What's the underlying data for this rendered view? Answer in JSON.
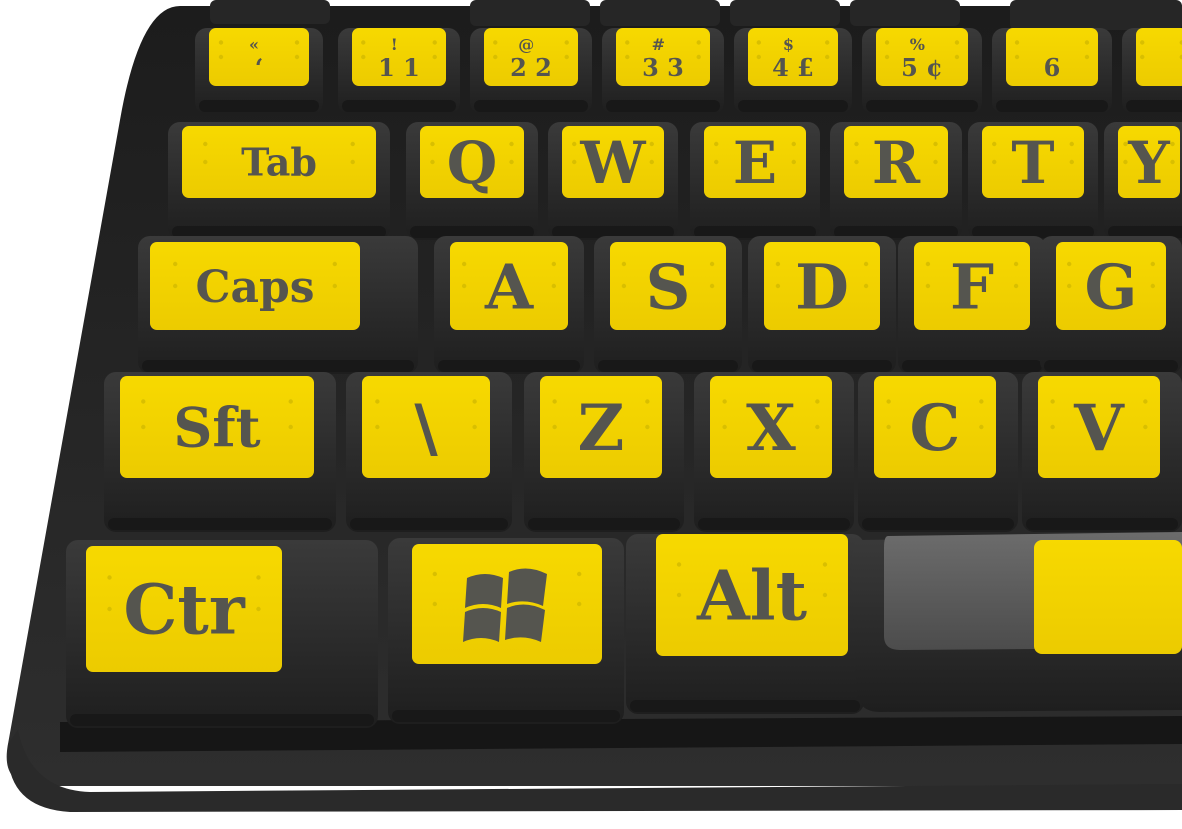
{
  "colors": {
    "key_label_yellow": "#f5d400",
    "key_body_black": "#2a2a2a",
    "legend_gray": "#55554f",
    "keyboard_frame": "#232323"
  },
  "keys": {
    "row_numbers": [
      {
        "name": "backtick-key",
        "top": "«",
        "main": "‘"
      },
      {
        "name": "key-1",
        "top": "!",
        "main": "1 1"
      },
      {
        "name": "key-2",
        "top": "@",
        "main": "2 2"
      },
      {
        "name": "key-3",
        "top": "#",
        "main": "3 3"
      },
      {
        "name": "key-4",
        "top": "$",
        "main": "4 £"
      },
      {
        "name": "key-5",
        "top": "%",
        "main": "5 ¢"
      },
      {
        "name": "key-6",
        "top": "",
        "main": "6"
      },
      {
        "name": "key-7",
        "top": "",
        "main": ""
      }
    ],
    "row_qwerty": [
      "Tab",
      "Q",
      "W",
      "E",
      "R",
      "T",
      "Y"
    ],
    "row_home": [
      "Caps",
      "A",
      "S",
      "D",
      "F",
      "G"
    ],
    "row_shift": [
      "Sft",
      "\\",
      "Z",
      "X",
      "C",
      "V"
    ],
    "row_bottom": {
      "ctrl": "Ctr",
      "alt": "Alt",
      "windows_icon": "windows-logo-icon",
      "space": ""
    }
  }
}
